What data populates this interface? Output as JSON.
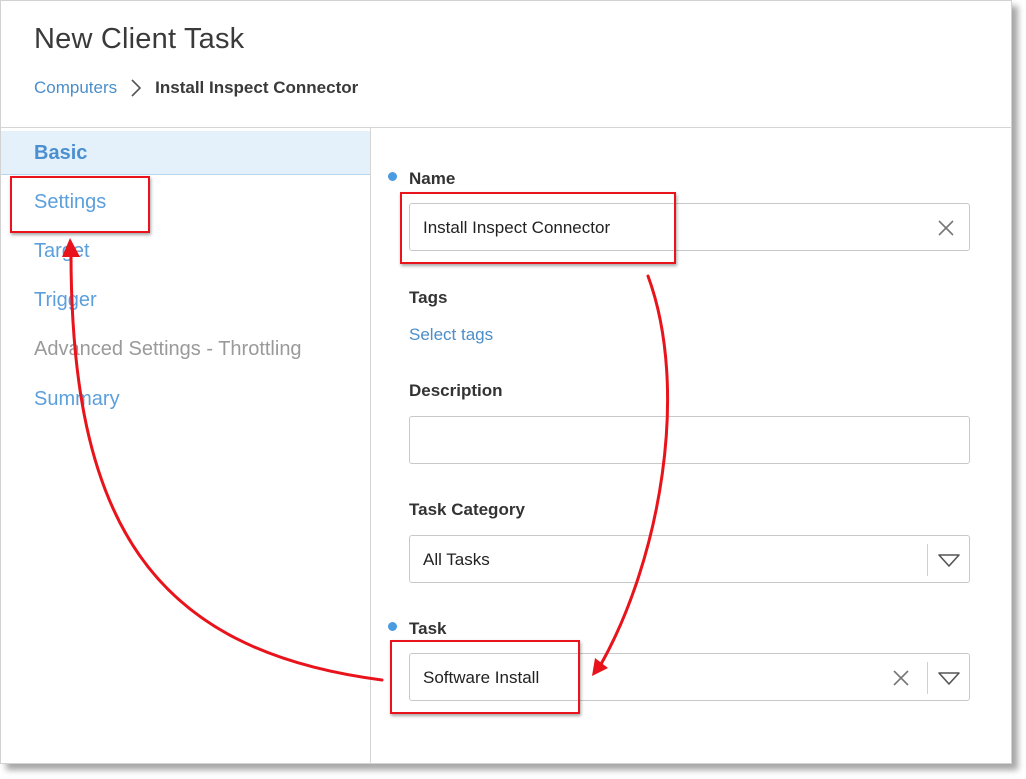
{
  "header": {
    "title": "New Client Task",
    "breadcrumb": {
      "parent": "Computers",
      "current": "Install Inspect Connector"
    }
  },
  "sidebar": {
    "items": [
      {
        "label": "Basic",
        "state": "active"
      },
      {
        "label": "Settings",
        "state": "enabled"
      },
      {
        "label": "Target",
        "state": "enabled"
      },
      {
        "label": "Trigger",
        "state": "enabled"
      },
      {
        "label": "Advanced Settings - Throttling",
        "state": "disabled"
      },
      {
        "label": "Summary",
        "state": "enabled"
      }
    ]
  },
  "form": {
    "name": {
      "label": "Name",
      "value": "Install Inspect Connector",
      "required": true
    },
    "tags": {
      "label": "Tags",
      "link": "Select tags"
    },
    "description": {
      "label": "Description",
      "value": ""
    },
    "task_category": {
      "label": "Task Category",
      "value": "All Tasks"
    },
    "task": {
      "label": "Task",
      "value": "Software Install",
      "required": true
    }
  },
  "colors": {
    "accent": "#4b8ec9",
    "active_nav_bg": "#e4f1fb",
    "required_dot": "#4a9be0",
    "annotation": "#e8131b"
  },
  "icons": {
    "breadcrumb_separator": "chevron-right-icon",
    "clear": "close-icon",
    "dropdown": "triangle-down-icon"
  }
}
